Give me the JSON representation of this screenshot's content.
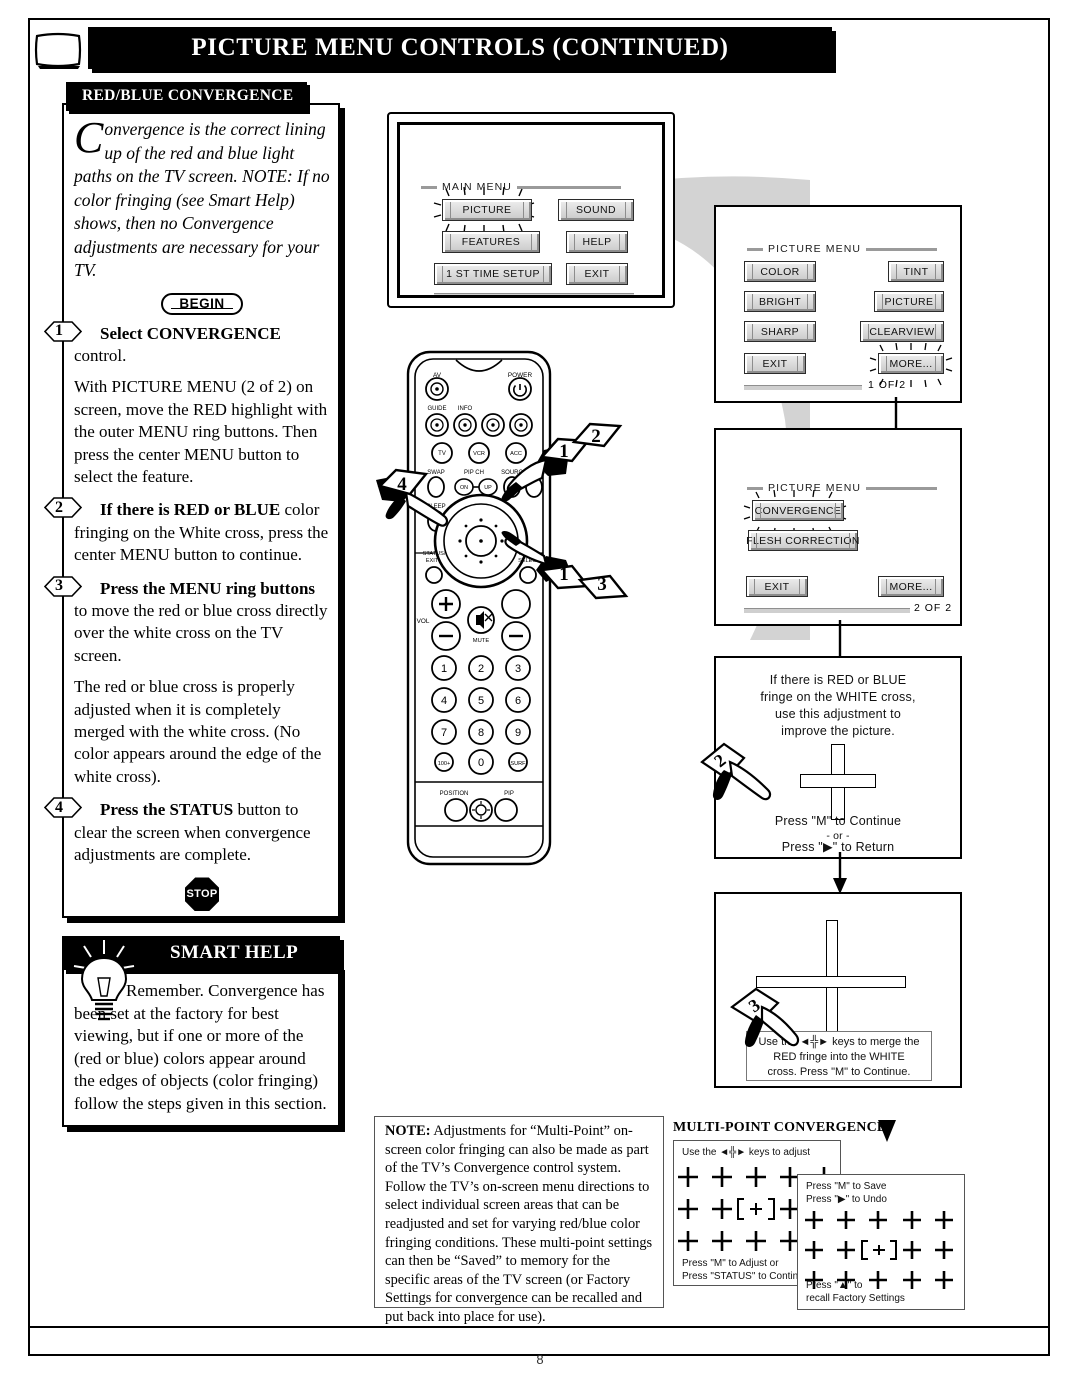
{
  "header": {
    "title": "PICTURE MENU CONTROLS (CONTINUED)",
    "tv_icon": "tv-screen-icon"
  },
  "page": {
    "number": "8"
  },
  "left_section": {
    "tab_label": "RED/BLUE CONVERGENCE",
    "intro_dropcap": "C",
    "intro_text": "onvergence is the correct lining up of the red and blue light paths on the TV screen. NOTE: If no color fringing (see Smart Help) shows, then no Convergence adjustments are necessary for your TV.",
    "begin_label": "BEGIN",
    "stop_label": "STOP",
    "steps": [
      {
        "number": "1",
        "lead": "Select CONVERGENCE",
        "rest": " control.",
        "paragraphs": [
          "With PICTURE MENU (2 of 2) on screen, move the RED highlight with the outer MENU ring buttons. Then press the center MENU button to select the feature."
        ]
      },
      {
        "number": "2",
        "lead": "If there is RED or BLUE",
        "rest": " color fringing on the White cross, press the center MENU button to continue.",
        "paragraphs": []
      },
      {
        "number": "3",
        "lead": "Press the MENU ring buttons",
        "rest": " to move the red or blue cross directly over the white cross on the TV screen.",
        "paragraphs": [
          "The red or blue cross is properly adjusted when it is completely merged with the white cross. (No color appears around the edge of the white cross)."
        ]
      },
      {
        "number": "4",
        "lead": "Press the STATUS",
        "rest": " button to clear the screen when convergence adjustments are complete.",
        "paragraphs": []
      }
    ]
  },
  "smart_help": {
    "title": "SMART HELP",
    "icon": "light-bulb-icon",
    "text": "Remember. Convergence has been set at the factory for best viewing, but if one or more of the (red or blue) colors appear around the edges of objects (color fringing) follow the steps given in this section."
  },
  "main_menu_screen": {
    "title": "MAIN MENU",
    "highlighted": "PICTURE",
    "buttons_left": [
      "PICTURE",
      "FEATURES",
      "1 ST TIME SETUP"
    ],
    "buttons_right": [
      "SOUND",
      "HELP",
      "EXIT"
    ]
  },
  "picture_menu_1": {
    "title": "PICTURE MENU",
    "page_indicator": "1 OF 2",
    "highlighted": "MORE...",
    "buttons_left": [
      "COLOR",
      "BRIGHT",
      "SHARP",
      "EXIT"
    ],
    "buttons_right": [
      "TINT",
      "PICTURE",
      "CLEARVIEW",
      "MORE..."
    ]
  },
  "picture_menu_2": {
    "title": "PICTURE MENU",
    "page_indicator": "2 OF 2",
    "highlighted": "CONVERGENCE",
    "buttons_left": [
      "CONVERGENCE",
      "FLESH CORRECTION"
    ],
    "buttons_bottom_left": "EXIT",
    "buttons_bottom_right": "MORE..."
  },
  "convergence_screen": {
    "line1": "If  there is RED or  BLUE",
    "line2": "fringe on the WHITE cross,",
    "line3": "use this adjustment to",
    "line4": "improve the picture.",
    "prompt1": "Press \"M\" to Continue",
    "prompt_or": "- or -",
    "prompt2": "Press \"▶\" to Return",
    "callout_number": "2"
  },
  "merge_screen": {
    "callout_number": "3",
    "caption_line1": "Use the ◄╬► keys to merge the",
    "caption_line2": "RED fringe into the WHITE",
    "caption_line3": "cross. Press \"M\" to Continue."
  },
  "note": {
    "label": "NOTE:",
    "text": " Adjustments for “Multi-Point” on-screen color fringing can also be made as part of the TV’s Convergence control system. Follow the TV’s on-screen menu directions to select individual screen areas that can be readjusted and set for varying red/blue color fringing conditions. These multi-point settings can then be “Saved” to memory for the specific areas of the TV screen (or Factory Settings for convergence can be recalled and put back into place for use)."
  },
  "multipoint": {
    "title": "MULTI-POINT CONVERGENCE",
    "screen_a": {
      "top_label": "Use the ◄╬► keys to adjust",
      "bottom_line1": "Press \"M\" to Adjust or",
      "bottom_line2": "Press \"STATUS\" to Continue"
    },
    "screen_b": {
      "top_line1": "Press \"M\" to Save",
      "top_line2": "Press \"▶\" to Undo",
      "bottom_line1": "Press \"▲\" to",
      "bottom_line2": "recall Factory Settings"
    }
  },
  "remote": {
    "labels": {
      "av": "AV",
      "power": "POWER",
      "guide": "GUIDE",
      "info": "INFO",
      "tv": "TV",
      "vcr": "VCR",
      "acc": "ACC",
      "swap": "SWAP",
      "pip_ch": "PIP CH",
      "pip_on": "ON",
      "pip_up": "UP",
      "source": "SOURCE",
      "freeze": "FREEZE",
      "sleep": "SLEEP",
      "status_exit": "STATUS/ EXIT",
      "menu_select": "MENU/ SELECT",
      "vol": "VOL",
      "mute": "MUTE",
      "position": "POSITION",
      "pip": "PIP"
    },
    "keypad": [
      "1",
      "2",
      "3",
      "4",
      "5",
      "6",
      "7",
      "8",
      "9",
      "100+",
      "0",
      "SURF"
    ],
    "callouts": [
      "1",
      "2",
      "4",
      "1",
      "3"
    ]
  }
}
